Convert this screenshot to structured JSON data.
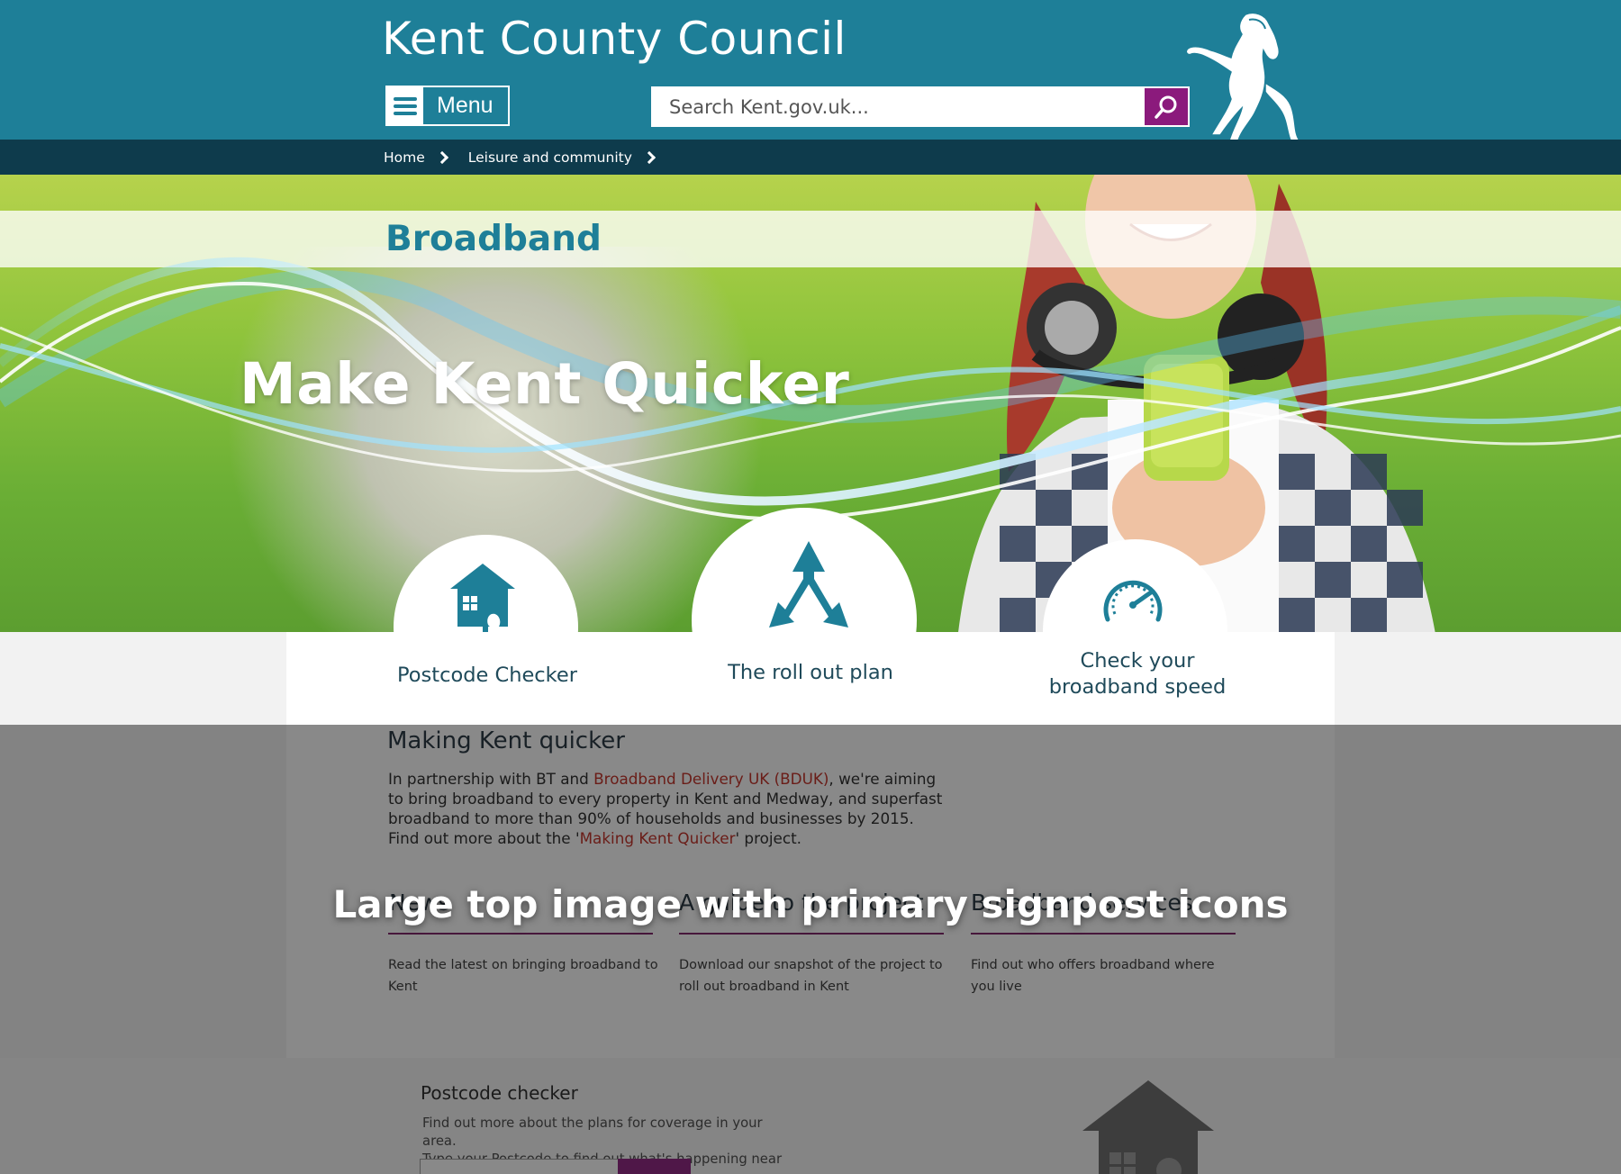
{
  "header": {
    "site_title": "Kent County Council",
    "menu_label": "Menu",
    "search_placeholder": "Search Kent.gov.uk...",
    "brand_color": "#1e7f98",
    "accent_color": "#8b1a7c"
  },
  "breadcrumb": {
    "items": [
      {
        "label": "Home"
      },
      {
        "label": "Leisure and community"
      }
    ]
  },
  "hero": {
    "page_title": "Broadband",
    "heading": "Make Kent Quicker"
  },
  "signposts": [
    {
      "label": "Postcode Checker",
      "icon": "house-jigsaw-icon"
    },
    {
      "label": "The roll out plan",
      "icon": "split-arrows-icon"
    },
    {
      "label_line1": "Check your",
      "label_line2": "broadband speed",
      "icon": "speedometer-icon"
    }
  ],
  "content": {
    "section_heading": "Making Kent quicker",
    "intro_part1": "In partnership with BT and ",
    "intro_link1": "Broadband Delivery UK (BDUK)",
    "intro_part2": ", we're aiming to bring broadband to every property in Kent and Medway, and superfast broadband to more than 90% of households and businesses by 2015. Find out more about the '",
    "intro_link2": "Making Kent Quicker",
    "intro_part3": "' project.",
    "columns": [
      {
        "heading": "News",
        "text": "Read the latest on bringing broadband to Kent"
      },
      {
        "heading": "A guide to the project",
        "text": "Download our snapshot of the project to roll out broadband in Kent"
      },
      {
        "heading": "Broadband services",
        "text": "Find out who offers broadband where you live"
      }
    ]
  },
  "postcode_checker": {
    "heading": "Postcode checker",
    "line1": "Find out more about the plans for coverage in your area.",
    "line2": "Type your Postcode to find out what's happening near you."
  },
  "overlay_caption": "Large top image with primary signpost icons"
}
